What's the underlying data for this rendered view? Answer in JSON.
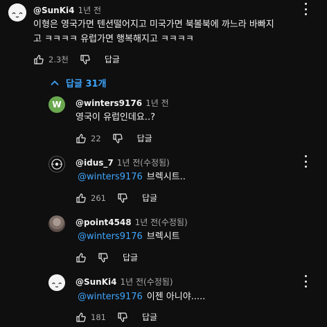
{
  "top_comment": {
    "handle": "@SunKi4",
    "time": "1년 전",
    "text_line1": "이형은 영국가면 텐션떨어지고 미국가면 북볼북에 까느라 바빠지",
    "text_line2": "고 ㅋㅋㅋㅋ 유럽가면 행복해지고 ㅋㅋㅋㅋ",
    "likes": "2.3천",
    "reply_label": "답글"
  },
  "replies_toggle": {
    "label": "답글 31개"
  },
  "replies": [
    {
      "handle": "@winters9176",
      "time": "1년 전",
      "avatar_letter": "W",
      "mention": "",
      "text": "영국이 유럽인데요..?",
      "likes": "22",
      "reply_label": "답글"
    },
    {
      "handle": "@idus_7",
      "time": "1년 전(수정됨)",
      "mention": "@winters9176",
      "text": "브렉시트..",
      "likes": "261",
      "reply_label": "답글"
    },
    {
      "handle": "@point4548",
      "time": "1년 전(수정됨)",
      "mention": "@winters9176",
      "text": "브렉시트",
      "likes": "",
      "reply_label": "답글"
    },
    {
      "handle": "@SunKi4",
      "time": "1년 전(수정됨)",
      "mention": "@winters9176",
      "text": "이젠 아니야.....",
      "likes": "181",
      "reply_label": "답글"
    }
  ],
  "icons": {
    "like": "thumb-up-icon",
    "dislike": "thumb-down-icon",
    "more": "more-vert-icon",
    "chevron": "chevron-up-icon"
  },
  "colors": {
    "background": "#0f0f0f",
    "accent": "#3ea6ff",
    "text": "#f1f1f1",
    "muted": "#aaaaaa"
  }
}
